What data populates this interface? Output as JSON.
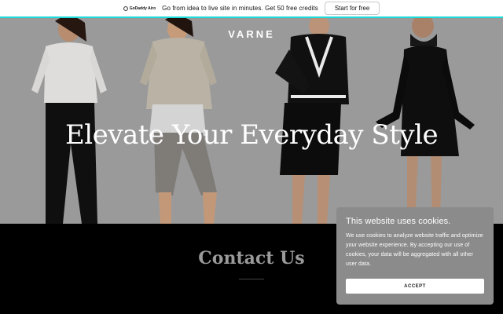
{
  "promo": {
    "logo_text": "GoDaddy Airo",
    "message": "Go from idea to live site in minutes. Get 50 free credits",
    "cta_label": "Start for free"
  },
  "hero": {
    "brand": "VARNE",
    "headline": "Elevate Your Everyday Style"
  },
  "contact": {
    "title": "Contact Us"
  },
  "cookie_banner": {
    "title": "This website uses cookies.",
    "body": "We use cookies to analyze website traffic and optimize your website experience. By accepting our use of cookies, your data will be aggregated with all other user data.",
    "accept_label": "ACCEPT"
  },
  "colors": {
    "promo_accent": "#1bdbdb",
    "hero_bg": "#a9a9a9",
    "cookie_bg": "#8b8b8b"
  }
}
